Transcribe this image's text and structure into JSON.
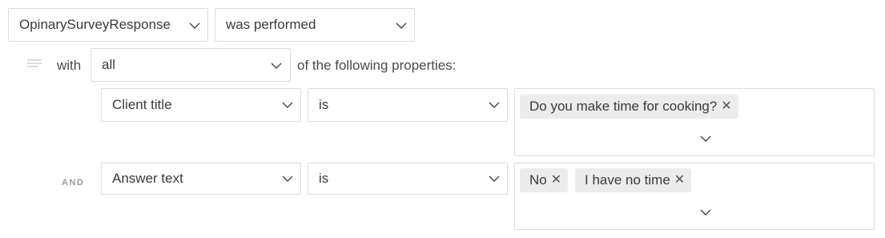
{
  "event": {
    "name": "OpinarySurveyResponse",
    "action": "was performed"
  },
  "properties": {
    "with_label": "with",
    "match": "all",
    "suffix": "of the following properties:"
  },
  "conditions": [
    {
      "prefix": "",
      "property": "Client title",
      "operator": "is",
      "values": [
        "Do you make time for cooking?"
      ]
    },
    {
      "prefix": "AND",
      "property": "Answer text",
      "operator": "is",
      "values": [
        "No",
        "I have no time"
      ]
    }
  ],
  "icons": {
    "chevron": "chevron-down-icon",
    "remove": "close-icon",
    "filter": "filter-lines-icon"
  },
  "colors": {
    "border": "#dcdcdc",
    "chip_bg": "#ececec",
    "text": "#3a3a3a",
    "muted": "#9a9a9a"
  }
}
